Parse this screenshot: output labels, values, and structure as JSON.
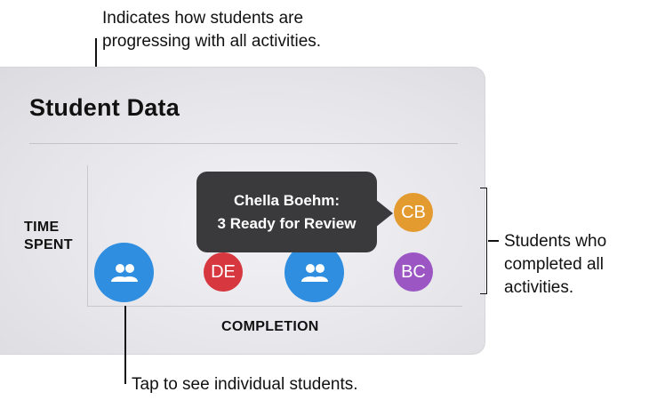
{
  "callouts": {
    "top": "Indicates how students are\nprogressing with all activities.",
    "right": "Students who\ncompleted all\nactivities.",
    "bottom": "Tap to see individual students."
  },
  "card": {
    "title": "Student Data",
    "y_axis_label": "TIME\nSPENT",
    "x_axis_label": "COMPLETION"
  },
  "tooltip": {
    "line1": "Chella Boehm:",
    "line2": "3 Ready for Review"
  },
  "students": [
    {
      "initials": "DE",
      "color": "#d7373f"
    },
    {
      "initials": "CB",
      "color": "#e39a2e"
    },
    {
      "initials": "BC",
      "color": "#9b56c4"
    }
  ],
  "groups": [
    {
      "icon": "group-icon",
      "color": "#2f8ee0"
    },
    {
      "icon": "group-icon",
      "color": "#2f8ee0"
    }
  ]
}
